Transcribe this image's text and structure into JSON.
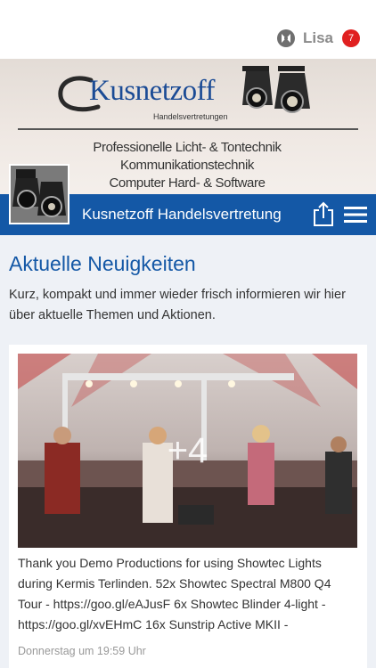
{
  "topbar": {
    "user_name": "Lisa",
    "notification_count": "7"
  },
  "banner": {
    "logo_name": "Kusnetzoff",
    "logo_subtitle": "Handelsvertretungen",
    "taglines": [
      "Professionelle Licht- & Tontechnik",
      "Kommunikationstechnik",
      "Computer Hard- & Software"
    ]
  },
  "navbar": {
    "title": "Kusnetzoff Handelsvertretung",
    "share_icon": "share-icon",
    "menu_icon": "hamburger-menu-icon"
  },
  "news": {
    "title": "Aktuelle Neuigkeiten",
    "intro": "Kurz, kompakt und immer wieder frisch informieren wir hier über aktuelle Themen und Aktionen."
  },
  "post": {
    "extra_photos": "+4",
    "text": "Thank you Demo Productions for using Showtec Lights during Kermis Terlinden. 52x Showtec Spectral M800 Q4 Tour - https://goo.gl/eAJusF 6x Showtec Blinder 4-light - https://goo.gl/xvEHmC 16x Sunstrip Active MKII -",
    "date": "Donnerstag um 19:59 Uhr"
  },
  "colors": {
    "brand_blue": "#1458a6",
    "badge_red": "#e02020",
    "background": "#eef1f6"
  }
}
